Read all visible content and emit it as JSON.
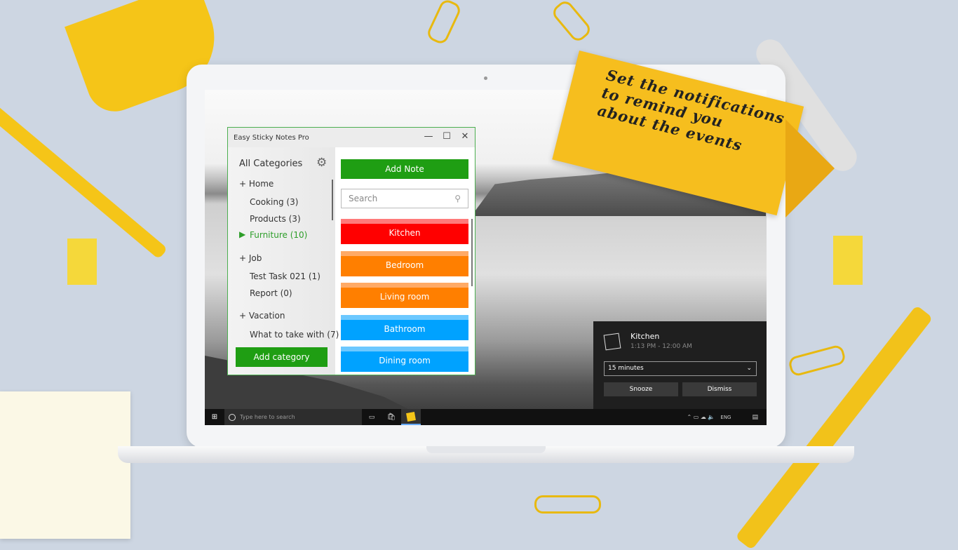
{
  "promo": {
    "banner_lines": [
      "Set the notifications",
      "to remind you",
      "about the events"
    ]
  },
  "window": {
    "title": "Easy Sticky Notes Pro",
    "minimize": "—",
    "maximize": "☐",
    "close": "✕"
  },
  "sidebar": {
    "header": "All Categories",
    "groups": [
      {
        "label": "+ Home",
        "items": [
          "Cooking (3)",
          "Products (3)",
          "Furniture (10)"
        ],
        "selected": "Furniture (10)"
      },
      {
        "label": "+ Job",
        "items": [
          "Test Task 021 (1)",
          "Report (0)"
        ]
      },
      {
        "label": "+ Vacation",
        "items": [
          "What to take with (7)"
        ]
      }
    ],
    "add_category": "Add category"
  },
  "main": {
    "add_note": "Add Note",
    "search_placeholder": "Search",
    "notes": [
      {
        "title": "Kitchen",
        "color": "#ff0000",
        "tab": "#ff7a7a"
      },
      {
        "title": "Bedroom",
        "color": "#ff7f00",
        "tab": "#ffaa66"
      },
      {
        "title": "Living room",
        "color": "#ff7f00",
        "tab": "#ffaa66"
      },
      {
        "title": "Bathroom",
        "color": "#00a2ff",
        "tab": "#6cc8ff"
      },
      {
        "title": "Dining room",
        "color": "#00a2ff",
        "tab": "#6cc8ff"
      }
    ]
  },
  "toast": {
    "title": "Kitchen",
    "time": "1:13 PM - 12:00 AM",
    "snooze_value": "15 minutes",
    "snooze": "Snooze",
    "dismiss": "Dismiss"
  },
  "taskbar": {
    "search_placeholder": "Type here to search",
    "lang": "ENG"
  },
  "colors": {
    "accent": "#1f9e13",
    "selected": "#2e9e2a"
  }
}
